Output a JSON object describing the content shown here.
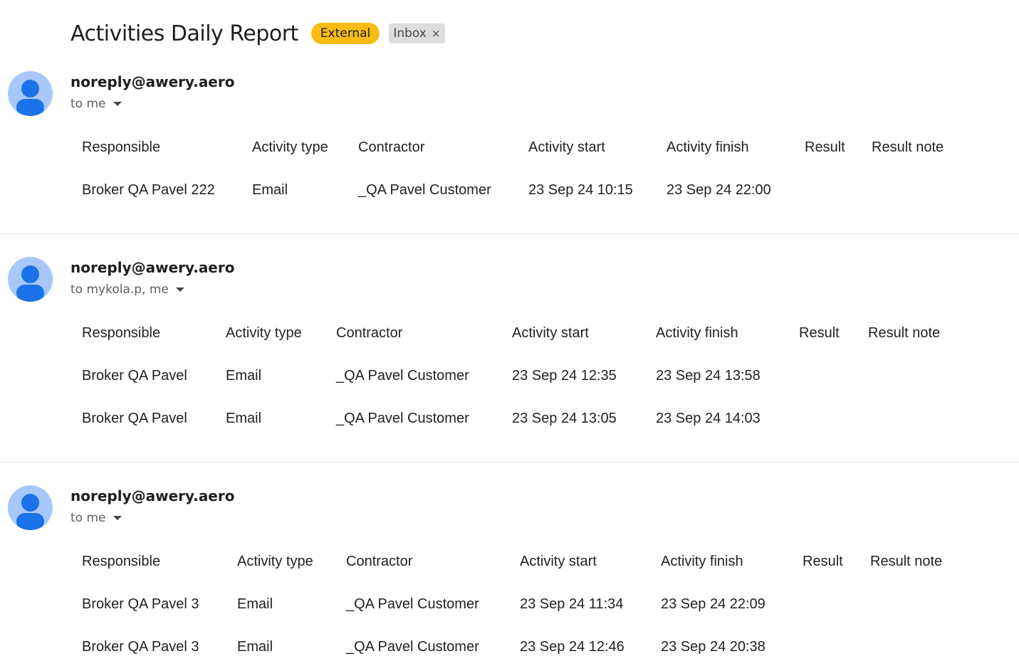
{
  "subject": {
    "title": "Activities Daily Report",
    "label_external": "External",
    "label_inbox": "Inbox",
    "label_inbox_close": "×"
  },
  "table_headers": [
    "Responsible",
    "Activity type",
    "Contractor",
    "Activity start",
    "Activity finish",
    "Result",
    "Result note"
  ],
  "messages": [
    {
      "sender": "noreply@awery.aero",
      "recipients": "to me",
      "rows": [
        [
          "Broker QA Pavel 222",
          "Email",
          "_QA Pavel Customer",
          "23 Sep 24 10:15",
          "23 Sep 24 22:00",
          "",
          ""
        ]
      ]
    },
    {
      "sender": "noreply@awery.aero",
      "recipients": "to mykola.p, me",
      "rows": [
        [
          "Broker QA Pavel",
          "Email",
          "_QA Pavel Customer",
          "23 Sep 24 12:35",
          "23 Sep 24 13:58",
          "",
          ""
        ],
        [
          "Broker QA Pavel",
          "Email",
          "_QA Pavel Customer",
          "23 Sep 24 13:05",
          "23 Sep 24 14:03",
          "",
          ""
        ]
      ]
    },
    {
      "sender": "noreply@awery.aero",
      "recipients": "to me",
      "rows": [
        [
          "Broker QA Pavel 3",
          "Email",
          "_QA Pavel Customer",
          "23 Sep 24 11:34",
          "23 Sep 24 22:09",
          "",
          ""
        ],
        [
          "Broker QA Pavel 3",
          "Email",
          "_QA Pavel Customer",
          "23 Sep 24 12:46",
          "23 Sep 24 20:38",
          "",
          ""
        ]
      ]
    }
  ],
  "colors": {
    "external_label": "#f9bc15",
    "inbox_label": "#dddddd",
    "avatar_bg": "#a8c7fa",
    "avatar_fg": "#1a73e8"
  },
  "icons": {
    "avatar": "person-icon",
    "recipients_toggle": "caret-down-icon",
    "label_remove": "close-icon"
  }
}
